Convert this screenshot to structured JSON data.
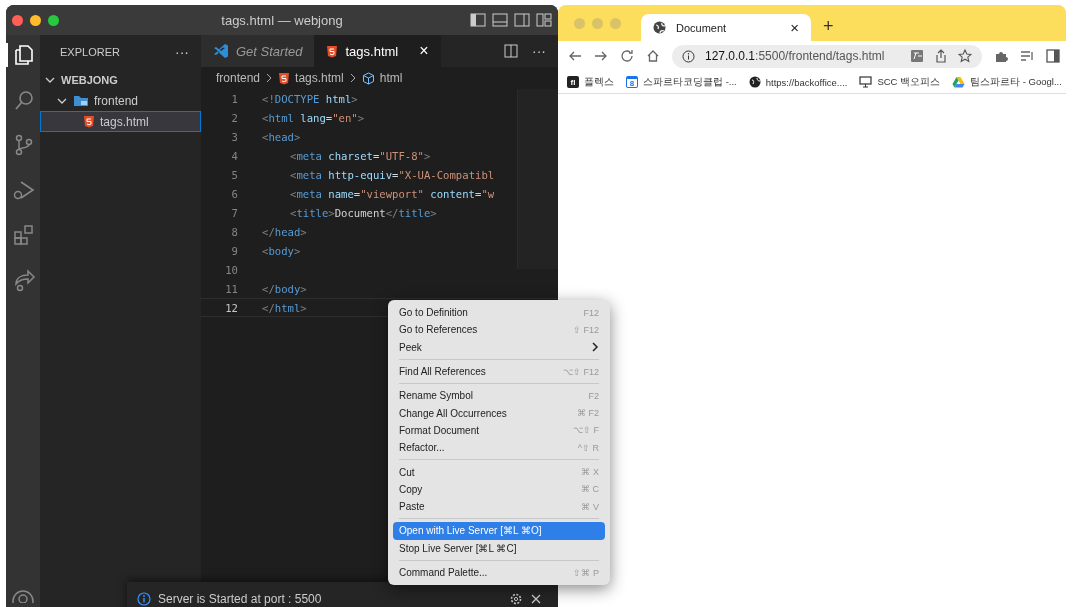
{
  "vscode": {
    "title": "tags.html — webjong",
    "activity_bar": [
      {
        "kind": "files",
        "selected": true
      },
      {
        "kind": "search",
        "selected": false
      },
      {
        "kind": "git",
        "selected": false
      },
      {
        "kind": "debug",
        "selected": false
      },
      {
        "kind": "extensions",
        "selected": false
      },
      {
        "kind": "share",
        "selected": false
      }
    ],
    "sidebar": {
      "title": "EXPLORER",
      "more": "···",
      "tree": [
        {
          "label": "WEBJONG",
          "kind": "root",
          "expanded": true,
          "children": [
            {
              "label": "frontend",
              "kind": "folder",
              "expanded": true,
              "children": [
                {
                  "label": "tags.html",
                  "kind": "html",
                  "selected": true
                }
              ]
            }
          ]
        }
      ]
    },
    "tabs": [
      {
        "label": "Get Started",
        "kind": "welcome",
        "selected": false
      },
      {
        "label": "tags.html",
        "kind": "html",
        "selected": true,
        "close": "×"
      }
    ],
    "editor_more": "···",
    "breadcrumb": [
      "frontend",
      "tags.html",
      "html"
    ],
    "lines": [
      {
        "number": "1",
        "current": false,
        "tokens": [
          {
            "kind": "punct",
            "text": "<!"
          },
          {
            "kind": "tag",
            "text": "DOCTYPE"
          },
          {
            "kind": "attr",
            "text": " html"
          },
          {
            "kind": "punct",
            "text": ">"
          }
        ]
      },
      {
        "number": "2",
        "current": false,
        "tokens": [
          {
            "kind": "punct",
            "text": "<"
          },
          {
            "kind": "tag",
            "text": "html"
          },
          {
            "kind": "attr",
            "text": " lang"
          },
          {
            "kind": "plain",
            "text": "="
          },
          {
            "kind": "string",
            "text": "\"en\""
          },
          {
            "kind": "punct",
            "text": ">"
          }
        ]
      },
      {
        "number": "3",
        "current": false,
        "tokens": [
          {
            "kind": "punct",
            "text": "<"
          },
          {
            "kind": "tag",
            "text": "head"
          },
          {
            "kind": "punct",
            "text": ">"
          }
        ],
        "children": [
          {
            "number": "4",
            "current": false,
            "tokens": [
              {
                "kind": "punct",
                "text": "<"
              },
              {
                "kind": "tag",
                "text": "meta"
              },
              {
                "kind": "attr",
                "text": " charset"
              },
              {
                "kind": "plain",
                "text": "="
              },
              {
                "kind": "string",
                "text": "\"UTF-8\""
              },
              {
                "kind": "punct",
                "text": ">"
              }
            ]
          },
          {
            "number": "5",
            "current": false,
            "tokens": [
              {
                "kind": "punct",
                "text": "<"
              },
              {
                "kind": "tag",
                "text": "meta"
              },
              {
                "kind": "attr",
                "text": " http-equiv"
              },
              {
                "kind": "plain",
                "text": "="
              },
              {
                "kind": "string",
                "text": "\"X-UA-Compatibl"
              }
            ]
          },
          {
            "number": "6",
            "current": false,
            "tokens": [
              {
                "kind": "punct",
                "text": "<"
              },
              {
                "kind": "tag",
                "text": "meta"
              },
              {
                "kind": "attr",
                "text": " name"
              },
              {
                "kind": "plain",
                "text": "="
              },
              {
                "kind": "string",
                "text": "\"viewport\""
              },
              {
                "kind": "attr",
                "text": " content"
              },
              {
                "kind": "plain",
                "text": "="
              },
              {
                "kind": "string",
                "text": "\"w"
              }
            ]
          },
          {
            "number": "7",
            "current": false,
            "tokens": [
              {
                "kind": "punct",
                "text": "<"
              },
              {
                "kind": "tag",
                "text": "title"
              },
              {
                "kind": "punct",
                "text": ">"
              },
              {
                "kind": "plain",
                "text": "Document"
              },
              {
                "kind": "punct",
                "text": "</"
              },
              {
                "kind": "tag",
                "text": "title"
              },
              {
                "kind": "punct",
                "text": ">"
              }
            ]
          }
        ]
      },
      {
        "number": "8",
        "current": false,
        "tokens": [
          {
            "kind": "punct",
            "text": "</"
          },
          {
            "kind": "tag",
            "text": "head"
          },
          {
            "kind": "punct",
            "text": ">"
          }
        ]
      },
      {
        "number": "9",
        "current": false,
        "tokens": [
          {
            "kind": "punct",
            "text": "<"
          },
          {
            "kind": "tag",
            "text": "body"
          },
          {
            "kind": "punct",
            "text": ">"
          }
        ]
      },
      {
        "number": "10",
        "current": false
      },
      {
        "number": "11",
        "current": false,
        "tokens": [
          {
            "kind": "punct",
            "text": "</"
          },
          {
            "kind": "tag",
            "text": "body"
          },
          {
            "kind": "punct",
            "text": ">"
          }
        ]
      },
      {
        "number": "12",
        "current": true,
        "tokens": [
          {
            "kind": "punct",
            "text": "</"
          },
          {
            "kind": "tag",
            "text": "html"
          },
          {
            "kind": "punct",
            "text": ">"
          }
        ]
      }
    ],
    "notification": {
      "message": "Server is Started at port : 5500"
    }
  },
  "context_menu": [
    [
      {
        "label": "Go to Definition",
        "shortcut": "F12",
        "selected": false
      },
      {
        "label": "Go to References",
        "shortcut": "⇧ F12",
        "selected": false
      },
      {
        "label": "Peek",
        "submenu": true,
        "selected": false
      }
    ],
    [
      {
        "label": "Find All References",
        "shortcut": "⌥⇧ F12",
        "selected": false
      }
    ],
    [
      {
        "label": "Rename Symbol",
        "shortcut": "F2",
        "selected": false
      },
      {
        "label": "Change All Occurrences",
        "shortcut": "⌘ F2",
        "selected": false
      },
      {
        "label": "Format Document",
        "shortcut": "⌥⇧ F",
        "selected": false
      },
      {
        "label": "Refactor...",
        "shortcut": "^⇧ R",
        "selected": false
      }
    ],
    [
      {
        "label": "Cut",
        "shortcut": "⌘ X",
        "selected": false
      },
      {
        "label": "Copy",
        "shortcut": "⌘ C",
        "selected": false
      },
      {
        "label": "Paste",
        "shortcut": "⌘ V",
        "selected": false
      }
    ],
    [
      {
        "label": "Open with Live Server [⌘L ⌘O]",
        "selected": true
      },
      {
        "label": "Stop Live Server [⌘L ⌘C]",
        "selected": false
      }
    ],
    [
      {
        "label": "Command Palette...",
        "shortcut": "⇧⌘ P",
        "selected": false
      }
    ]
  ],
  "browser": {
    "tab": {
      "title": "Document",
      "close": "×"
    },
    "new_tab": "+",
    "url_host": "127.0.0.1",
    "url_path": ":5500/frontend/tags.html",
    "bookmarks": [
      {
        "label": "플렉스",
        "kind": "flex",
        "badge": "fl"
      },
      {
        "label": "스파르타코딩클럽 -...",
        "kind": "calendar",
        "badge": "8"
      },
      {
        "label": "https://backoffice....",
        "kind": "globe"
      },
      {
        "label": "SCC 백오피스",
        "kind": "monitor"
      },
      {
        "label": "팀스파르타 - Googl...",
        "kind": "drive"
      }
    ]
  }
}
